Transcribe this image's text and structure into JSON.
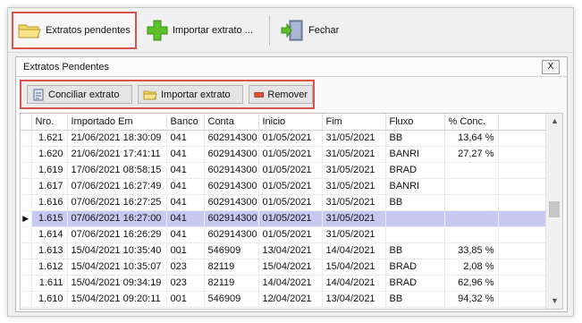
{
  "toolbar": {
    "pending_label": "Extratos pendentes",
    "import_label": "Importar extrato ...",
    "close_label": "Fechar"
  },
  "panel": {
    "title": "Extratos Pendentes",
    "close_label": "X"
  },
  "actions": {
    "conciliar_label": "Conciliar extrato",
    "importar_label": "Importar extrato",
    "remover_label": "Remover"
  },
  "table": {
    "columns": [
      "Nro.",
      "Importado Em",
      "Banco",
      "Conta",
      "Inicio",
      "Fim",
      "Fluxo",
      "% Conc."
    ],
    "rows": [
      [
        "1.621",
        "21/06/2021 18:30:09",
        "041",
        "602914300",
        "01/05/2021",
        "31/05/2021",
        "BB",
        "13,64 %"
      ],
      [
        "1.620",
        "21/06/2021 17:41:11",
        "041",
        "602914300",
        "01/05/2021",
        "31/05/2021",
        "BANRI",
        "27,27 %"
      ],
      [
        "1.619",
        "17/06/2021 08:58:15",
        "041",
        "602914300",
        "01/05/2021",
        "31/05/2021",
        "BRAD",
        ""
      ],
      [
        "1.617",
        "07/06/2021 16:27:49",
        "041",
        "602914300",
        "01/05/2021",
        "31/05/2021",
        "BANRI",
        ""
      ],
      [
        "1.616",
        "07/06/2021 16:27:25",
        "041",
        "602914300",
        "01/05/2021",
        "31/05/2021",
        "BB",
        ""
      ],
      [
        "1.615",
        "07/06/2021 16:27:00",
        "041",
        "602914300",
        "01/05/2021",
        "31/05/2021",
        "",
        ""
      ],
      [
        "1.614",
        "07/06/2021 16:26:29",
        "041",
        "602914300",
        "01/05/2021",
        "31/05/2021",
        "",
        ""
      ],
      [
        "1.613",
        "15/04/2021 10:35:40",
        "001",
        "546909",
        "13/04/2021",
        "14/04/2021",
        "BB",
        "33,85 %"
      ],
      [
        "1.612",
        "15/04/2021 10:35:07",
        "023",
        "82119",
        "15/04/2021",
        "15/04/2021",
        "BRAD",
        "2,08 %"
      ],
      [
        "1.611",
        "15/04/2021 09:34:19",
        "023",
        "82119",
        "14/04/2021",
        "14/04/2021",
        "BRAD",
        "62,96 %"
      ],
      [
        "1.610",
        "15/04/2021 09:20:11",
        "001",
        "546909",
        "12/04/2021",
        "13/04/2021",
        "BB",
        "94,32 %"
      ]
    ],
    "selected_index": 5,
    "current_row_marker": "▶"
  },
  "scrollbar": {
    "up_glyph": "▲",
    "down_glyph": "▼"
  },
  "colors": {
    "highlight_border": "#d9534f",
    "selected_row": "#c8c8f0"
  }
}
